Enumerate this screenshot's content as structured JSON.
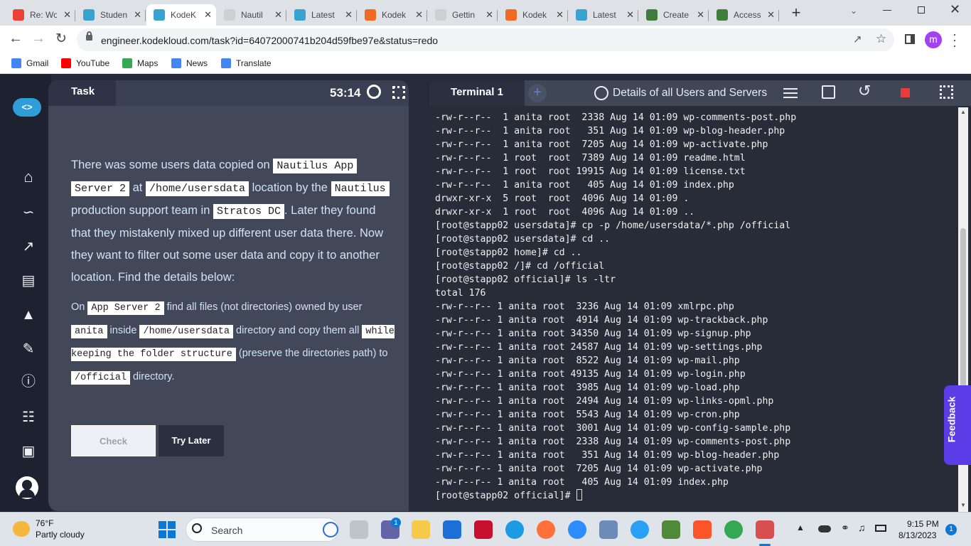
{
  "browser": {
    "tabs": [
      {
        "label": "Re: Wo",
        "icon": "gmail-icon",
        "color": "#ea4335"
      },
      {
        "label": "Studen",
        "icon": "kodekloud-eye-icon",
        "color": "#38a3d1"
      },
      {
        "label": "KodeK",
        "icon": "kodekloud-eye-icon",
        "color": "#38a3d1",
        "active": true
      },
      {
        "label": "Nautil",
        "icon": "doc-icon",
        "color": "#cfcfcf"
      },
      {
        "label": "Latest",
        "icon": "kodekloud-eye-icon",
        "color": "#38a3d1"
      },
      {
        "label": "Kodek",
        "icon": "kodekloud-orange-icon",
        "color": "#f26a21"
      },
      {
        "label": "Gettin",
        "icon": "doc-icon",
        "color": "#cfcfcf"
      },
      {
        "label": "Kodek",
        "icon": "kodekloud-orange-icon",
        "color": "#f26a21"
      },
      {
        "label": "Latest",
        "icon": "kodekloud-eye-icon",
        "color": "#38a3d1"
      },
      {
        "label": "Create",
        "icon": "tree-icon",
        "color": "#3f7d3a"
      },
      {
        "label": "Access",
        "icon": "tree-icon",
        "color": "#3f7d3a"
      }
    ],
    "new_tab": "+",
    "url": "engineer.kodekloud.com/task?id=64072000741b204d59fbe97e&status=redo",
    "profile_initial": "m",
    "bookmarks": [
      {
        "label": "Gmail",
        "color": "#4285f4"
      },
      {
        "label": "YouTube",
        "color": "#ff0000"
      },
      {
        "label": "Maps",
        "color": "#34a853"
      },
      {
        "label": "News",
        "color": "#4285f4"
      },
      {
        "label": "Translate",
        "color": "#4285f4"
      }
    ]
  },
  "task": {
    "tab_label": "Task",
    "timer": "53:14",
    "p1": [
      {
        "t": "There was some users data copied on "
      },
      {
        "c": "Nautilus App"
      },
      {
        "t": " "
      },
      {
        "c": "Server 2"
      },
      {
        "t": " at "
      },
      {
        "c": "/home/usersdata"
      },
      {
        "t": " location by the "
      },
      {
        "c": "Nautilus"
      },
      {
        "t": " production support team in "
      },
      {
        "c": "Stratos DC"
      },
      {
        "t": ". Later they found that they mistakenly mixed up different user data there. Now they want to filter out some user data and copy it to another location. Find the details below:"
      }
    ],
    "p2": [
      {
        "t": "On "
      },
      {
        "c": "App Server 2"
      },
      {
        "t": " find all files (not directories) owned by user "
      },
      {
        "c": "anita"
      },
      {
        "t": " inside "
      },
      {
        "c": "/home/usersdata"
      },
      {
        "t": " directory and copy them all "
      },
      {
        "c": "while keeping the folder structure"
      },
      {
        "t": " (preserve the directories path) to "
      },
      {
        "c": "/official"
      },
      {
        "t": " directory."
      }
    ],
    "check_label": "Check",
    "later_label": "Try Later"
  },
  "terminal": {
    "tab_label": "Terminal 1",
    "servers_label": "Details of all Users and Servers",
    "lines": [
      "-rw-r--r--  1 anita root  2338 Aug 14 01:09 wp-comments-post.php",
      "-rw-r--r--  1 anita root   351 Aug 14 01:09 wp-blog-header.php",
      "-rw-r--r--  1 anita root  7205 Aug 14 01:09 wp-activate.php",
      "-rw-r--r--  1 root  root  7389 Aug 14 01:09 readme.html",
      "-rw-r--r--  1 root  root 19915 Aug 14 01:09 license.txt",
      "-rw-r--r--  1 anita root   405 Aug 14 01:09 index.php",
      "drwxr-xr-x  5 root  root  4096 Aug 14 01:09 .",
      "drwxr-xr-x  1 root  root  4096 Aug 14 01:09 ..",
      "[root@stapp02 usersdata]# cp -p /home/usersdata/*.php /official",
      "[root@stapp02 usersdata]# cd ..",
      "[root@stapp02 home]# cd ..",
      "[root@stapp02 /]# cd /official",
      "[root@stapp02 official]# ls -ltr",
      "total 176",
      "-rw-r--r-- 1 anita root  3236 Aug 14 01:09 xmlrpc.php",
      "-rw-r--r-- 1 anita root  4914 Aug 14 01:09 wp-trackback.php",
      "-rw-r--r-- 1 anita root 34350 Aug 14 01:09 wp-signup.php",
      "-rw-r--r-- 1 anita root 24587 Aug 14 01:09 wp-settings.php",
      "-rw-r--r-- 1 anita root  8522 Aug 14 01:09 wp-mail.php",
      "-rw-r--r-- 1 anita root 49135 Aug 14 01:09 wp-login.php",
      "-rw-r--r-- 1 anita root  3985 Aug 14 01:09 wp-load.php",
      "-rw-r--r-- 1 anita root  2494 Aug 14 01:09 wp-links-opml.php",
      "-rw-r--r-- 1 anita root  5543 Aug 14 01:09 wp-cron.php",
      "-rw-r--r-- 1 anita root  3001 Aug 14 01:09 wp-config-sample.php",
      "-rw-r--r-- 1 anita root  2338 Aug 14 01:09 wp-comments-post.php",
      "-rw-r--r-- 1 anita root   351 Aug 14 01:09 wp-blog-header.php",
      "-rw-r--r-- 1 anita root  7205 Aug 14 01:09 wp-activate.php",
      "-rw-r--r-- 1 anita root   405 Aug 14 01:09 index.php"
    ],
    "prompt": "[root@stapp02 official]# ",
    "scroll_fraction": 0.55
  },
  "feedback_label": "Feedback",
  "taskbar": {
    "weather_temp": "76°F",
    "weather_desc": "Partly cloudy",
    "search_placeholder": "Search",
    "time": "9:15 PM",
    "date": "8/13/2023",
    "notification_count": "1",
    "chat_badge": "1"
  }
}
